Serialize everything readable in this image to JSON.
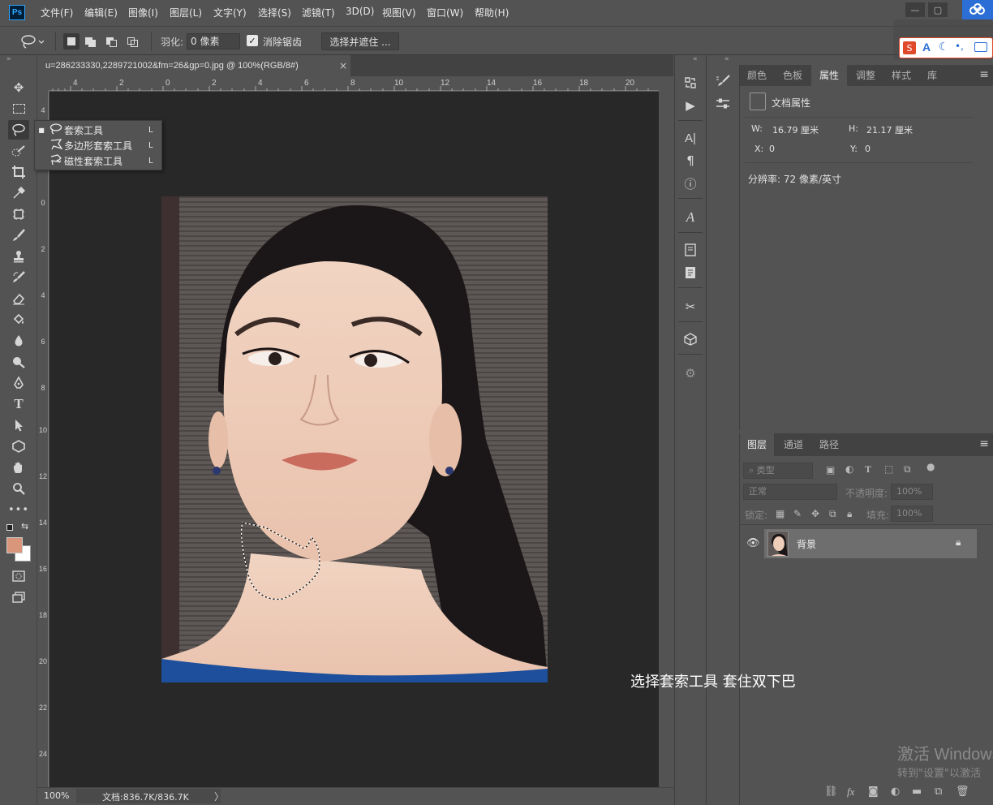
{
  "app": {
    "logo": "Ps",
    "menu": [
      "文件(F)",
      "编辑(E)",
      "图像(I)",
      "图层(L)",
      "文字(Y)",
      "选择(S)",
      "滤镜(T)",
      "3D(D)",
      "视图(V)",
      "窗口(W)",
      "帮助(H)"
    ]
  },
  "options": {
    "feather_label": "羽化:",
    "feather_value": "0 像素",
    "antialias_label": "消除锯齿",
    "select_mask_label": "选择并遮住 ..."
  },
  "flyout": {
    "items": [
      {
        "label": "套索工具",
        "key": "L",
        "icon": "lasso-icon",
        "selected": true
      },
      {
        "label": "多边形套索工具",
        "key": "L",
        "icon": "polygonal-lasso-icon",
        "selected": false
      },
      {
        "label": "磁性套索工具",
        "key": "L",
        "icon": "magnetic-lasso-icon",
        "selected": false
      }
    ]
  },
  "document": {
    "tab_title": "u=286233330,2289721002&fm=26&gp=0.jpg @ 100%(RGB/8#)",
    "close": "×",
    "ruler_top": [
      "4",
      "2",
      "0",
      "2",
      "4",
      "6",
      "8",
      "10",
      "12",
      "14",
      "16",
      "18",
      "20"
    ],
    "ruler_left": [
      "4",
      "2",
      "0",
      "2",
      "4",
      "6",
      "8",
      "10",
      "12",
      "14",
      "16",
      "18",
      "20",
      "22",
      "24"
    ]
  },
  "status": {
    "zoom": "100%",
    "doc_size": "文档:836.7K/836.7K",
    "arrow": "〉"
  },
  "properties": {
    "tabs": [
      "颜色",
      "色板",
      "属性",
      "调整",
      "样式",
      "库"
    ],
    "active_tab": "属性",
    "title": "文档属性",
    "w_label": "W:",
    "w_value": "16.79 厘米",
    "h_label": "H:",
    "h_value": "21.17 厘米",
    "x_label": "X:",
    "x_value": "0",
    "y_label": "Y:",
    "y_value": "0",
    "resolution": "分辨率: 72 像素/英寸"
  },
  "layers": {
    "tabs": [
      "图层",
      "通道",
      "路径"
    ],
    "active_tab": "图层",
    "filter_placeholder": "类型",
    "blend_mode": "正常",
    "opacity_label": "不透明度:",
    "opacity_value": "100%",
    "lock_label": "锁定:",
    "fill_label": "填充:",
    "fill_value": "100%",
    "layer_name": "背景"
  },
  "caption": "选择套索工具    套住双下巴",
  "watermark": {
    "line1": "激活 Windows",
    "line2": "转到\"设置\"以激活"
  },
  "colors": {
    "foreground": "#d9967b",
    "background": "#ffffff",
    "accent": "#31a8ff"
  }
}
